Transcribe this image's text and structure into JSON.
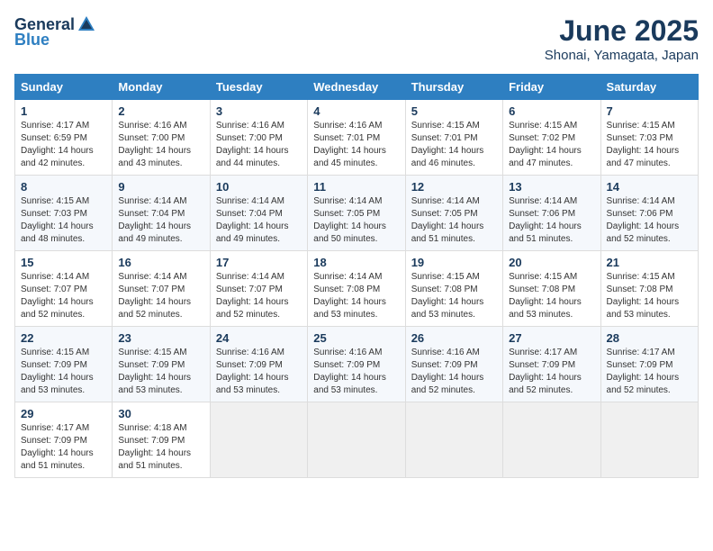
{
  "header": {
    "logo_general": "General",
    "logo_blue": "Blue",
    "title": "June 2025",
    "subtitle": "Shonai, Yamagata, Japan"
  },
  "calendar": {
    "days_of_week": [
      "Sunday",
      "Monday",
      "Tuesday",
      "Wednesday",
      "Thursday",
      "Friday",
      "Saturday"
    ],
    "weeks": [
      [
        null,
        {
          "day": "2",
          "sunrise": "4:16 AM",
          "sunset": "7:00 PM",
          "daylight": "14 hours and 43 minutes."
        },
        {
          "day": "3",
          "sunrise": "4:16 AM",
          "sunset": "7:00 PM",
          "daylight": "14 hours and 44 minutes."
        },
        {
          "day": "4",
          "sunrise": "4:16 AM",
          "sunset": "7:01 PM",
          "daylight": "14 hours and 45 minutes."
        },
        {
          "day": "5",
          "sunrise": "4:15 AM",
          "sunset": "7:01 PM",
          "daylight": "14 hours and 46 minutes."
        },
        {
          "day": "6",
          "sunrise": "4:15 AM",
          "sunset": "7:02 PM",
          "daylight": "14 hours and 47 minutes."
        },
        {
          "day": "7",
          "sunrise": "4:15 AM",
          "sunset": "7:03 PM",
          "daylight": "14 hours and 47 minutes."
        }
      ],
      [
        {
          "day": "1",
          "sunrise": "4:17 AM",
          "sunset": "6:59 PM",
          "daylight": "14 hours and 42 minutes."
        },
        null,
        null,
        null,
        null,
        null,
        null
      ],
      [
        {
          "day": "8",
          "sunrise": "4:15 AM",
          "sunset": "7:03 PM",
          "daylight": "14 hours and 48 minutes."
        },
        {
          "day": "9",
          "sunrise": "4:14 AM",
          "sunset": "7:04 PM",
          "daylight": "14 hours and 49 minutes."
        },
        {
          "day": "10",
          "sunrise": "4:14 AM",
          "sunset": "7:04 PM",
          "daylight": "14 hours and 49 minutes."
        },
        {
          "day": "11",
          "sunrise": "4:14 AM",
          "sunset": "7:05 PM",
          "daylight": "14 hours and 50 minutes."
        },
        {
          "day": "12",
          "sunrise": "4:14 AM",
          "sunset": "7:05 PM",
          "daylight": "14 hours and 51 minutes."
        },
        {
          "day": "13",
          "sunrise": "4:14 AM",
          "sunset": "7:06 PM",
          "daylight": "14 hours and 51 minutes."
        },
        {
          "day": "14",
          "sunrise": "4:14 AM",
          "sunset": "7:06 PM",
          "daylight": "14 hours and 52 minutes."
        }
      ],
      [
        {
          "day": "15",
          "sunrise": "4:14 AM",
          "sunset": "7:07 PM",
          "daylight": "14 hours and 52 minutes."
        },
        {
          "day": "16",
          "sunrise": "4:14 AM",
          "sunset": "7:07 PM",
          "daylight": "14 hours and 52 minutes."
        },
        {
          "day": "17",
          "sunrise": "4:14 AM",
          "sunset": "7:07 PM",
          "daylight": "14 hours and 52 minutes."
        },
        {
          "day": "18",
          "sunrise": "4:14 AM",
          "sunset": "7:08 PM",
          "daylight": "14 hours and 53 minutes."
        },
        {
          "day": "19",
          "sunrise": "4:15 AM",
          "sunset": "7:08 PM",
          "daylight": "14 hours and 53 minutes."
        },
        {
          "day": "20",
          "sunrise": "4:15 AM",
          "sunset": "7:08 PM",
          "daylight": "14 hours and 53 minutes."
        },
        {
          "day": "21",
          "sunrise": "4:15 AM",
          "sunset": "7:08 PM",
          "daylight": "14 hours and 53 minutes."
        }
      ],
      [
        {
          "day": "22",
          "sunrise": "4:15 AM",
          "sunset": "7:09 PM",
          "daylight": "14 hours and 53 minutes."
        },
        {
          "day": "23",
          "sunrise": "4:15 AM",
          "sunset": "7:09 PM",
          "daylight": "14 hours and 53 minutes."
        },
        {
          "day": "24",
          "sunrise": "4:16 AM",
          "sunset": "7:09 PM",
          "daylight": "14 hours and 53 minutes."
        },
        {
          "day": "25",
          "sunrise": "4:16 AM",
          "sunset": "7:09 PM",
          "daylight": "14 hours and 53 minutes."
        },
        {
          "day": "26",
          "sunrise": "4:16 AM",
          "sunset": "7:09 PM",
          "daylight": "14 hours and 52 minutes."
        },
        {
          "day": "27",
          "sunrise": "4:17 AM",
          "sunset": "7:09 PM",
          "daylight": "14 hours and 52 minutes."
        },
        {
          "day": "28",
          "sunrise": "4:17 AM",
          "sunset": "7:09 PM",
          "daylight": "14 hours and 52 minutes."
        }
      ],
      [
        {
          "day": "29",
          "sunrise": "4:17 AM",
          "sunset": "7:09 PM",
          "daylight": "14 hours and 51 minutes."
        },
        {
          "day": "30",
          "sunrise": "4:18 AM",
          "sunset": "7:09 PM",
          "daylight": "14 hours and 51 minutes."
        },
        null,
        null,
        null,
        null,
        null
      ]
    ]
  }
}
